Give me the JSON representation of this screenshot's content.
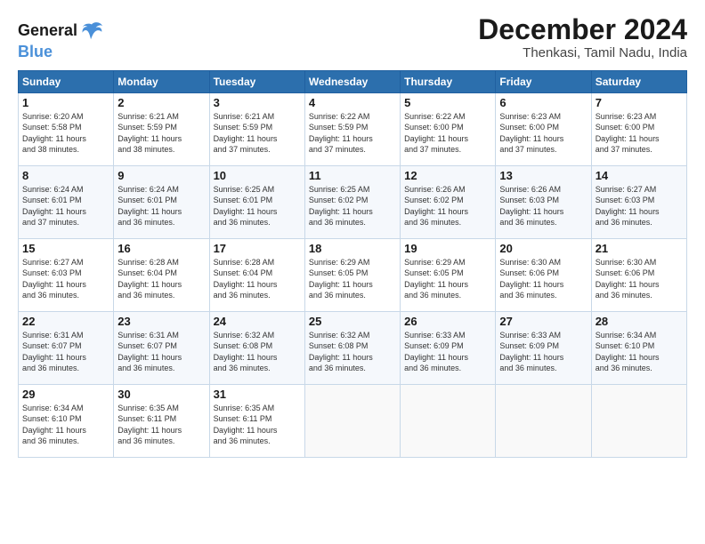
{
  "logo": {
    "line1": "General",
    "line2": "Blue"
  },
  "title": "December 2024",
  "subtitle": "Thenkasi, Tamil Nadu, India",
  "days_of_week": [
    "Sunday",
    "Monday",
    "Tuesday",
    "Wednesday",
    "Thursday",
    "Friday",
    "Saturday"
  ],
  "weeks": [
    [
      {
        "day": "1",
        "info": "Sunrise: 6:20 AM\nSunset: 5:58 PM\nDaylight: 11 hours\nand 38 minutes."
      },
      {
        "day": "2",
        "info": "Sunrise: 6:21 AM\nSunset: 5:59 PM\nDaylight: 11 hours\nand 38 minutes."
      },
      {
        "day": "3",
        "info": "Sunrise: 6:21 AM\nSunset: 5:59 PM\nDaylight: 11 hours\nand 37 minutes."
      },
      {
        "day": "4",
        "info": "Sunrise: 6:22 AM\nSunset: 5:59 PM\nDaylight: 11 hours\nand 37 minutes."
      },
      {
        "day": "5",
        "info": "Sunrise: 6:22 AM\nSunset: 6:00 PM\nDaylight: 11 hours\nand 37 minutes."
      },
      {
        "day": "6",
        "info": "Sunrise: 6:23 AM\nSunset: 6:00 PM\nDaylight: 11 hours\nand 37 minutes."
      },
      {
        "day": "7",
        "info": "Sunrise: 6:23 AM\nSunset: 6:00 PM\nDaylight: 11 hours\nand 37 minutes."
      }
    ],
    [
      {
        "day": "8",
        "info": "Sunrise: 6:24 AM\nSunset: 6:01 PM\nDaylight: 11 hours\nand 37 minutes."
      },
      {
        "day": "9",
        "info": "Sunrise: 6:24 AM\nSunset: 6:01 PM\nDaylight: 11 hours\nand 36 minutes."
      },
      {
        "day": "10",
        "info": "Sunrise: 6:25 AM\nSunset: 6:01 PM\nDaylight: 11 hours\nand 36 minutes."
      },
      {
        "day": "11",
        "info": "Sunrise: 6:25 AM\nSunset: 6:02 PM\nDaylight: 11 hours\nand 36 minutes."
      },
      {
        "day": "12",
        "info": "Sunrise: 6:26 AM\nSunset: 6:02 PM\nDaylight: 11 hours\nand 36 minutes."
      },
      {
        "day": "13",
        "info": "Sunrise: 6:26 AM\nSunset: 6:03 PM\nDaylight: 11 hours\nand 36 minutes."
      },
      {
        "day": "14",
        "info": "Sunrise: 6:27 AM\nSunset: 6:03 PM\nDaylight: 11 hours\nand 36 minutes."
      }
    ],
    [
      {
        "day": "15",
        "info": "Sunrise: 6:27 AM\nSunset: 6:03 PM\nDaylight: 11 hours\nand 36 minutes."
      },
      {
        "day": "16",
        "info": "Sunrise: 6:28 AM\nSunset: 6:04 PM\nDaylight: 11 hours\nand 36 minutes."
      },
      {
        "day": "17",
        "info": "Sunrise: 6:28 AM\nSunset: 6:04 PM\nDaylight: 11 hours\nand 36 minutes."
      },
      {
        "day": "18",
        "info": "Sunrise: 6:29 AM\nSunset: 6:05 PM\nDaylight: 11 hours\nand 36 minutes."
      },
      {
        "day": "19",
        "info": "Sunrise: 6:29 AM\nSunset: 6:05 PM\nDaylight: 11 hours\nand 36 minutes."
      },
      {
        "day": "20",
        "info": "Sunrise: 6:30 AM\nSunset: 6:06 PM\nDaylight: 11 hours\nand 36 minutes."
      },
      {
        "day": "21",
        "info": "Sunrise: 6:30 AM\nSunset: 6:06 PM\nDaylight: 11 hours\nand 36 minutes."
      }
    ],
    [
      {
        "day": "22",
        "info": "Sunrise: 6:31 AM\nSunset: 6:07 PM\nDaylight: 11 hours\nand 36 minutes."
      },
      {
        "day": "23",
        "info": "Sunrise: 6:31 AM\nSunset: 6:07 PM\nDaylight: 11 hours\nand 36 minutes."
      },
      {
        "day": "24",
        "info": "Sunrise: 6:32 AM\nSunset: 6:08 PM\nDaylight: 11 hours\nand 36 minutes."
      },
      {
        "day": "25",
        "info": "Sunrise: 6:32 AM\nSunset: 6:08 PM\nDaylight: 11 hours\nand 36 minutes."
      },
      {
        "day": "26",
        "info": "Sunrise: 6:33 AM\nSunset: 6:09 PM\nDaylight: 11 hours\nand 36 minutes."
      },
      {
        "day": "27",
        "info": "Sunrise: 6:33 AM\nSunset: 6:09 PM\nDaylight: 11 hours\nand 36 minutes."
      },
      {
        "day": "28",
        "info": "Sunrise: 6:34 AM\nSunset: 6:10 PM\nDaylight: 11 hours\nand 36 minutes."
      }
    ],
    [
      {
        "day": "29",
        "info": "Sunrise: 6:34 AM\nSunset: 6:10 PM\nDaylight: 11 hours\nand 36 minutes."
      },
      {
        "day": "30",
        "info": "Sunrise: 6:35 AM\nSunset: 6:11 PM\nDaylight: 11 hours\nand 36 minutes."
      },
      {
        "day": "31",
        "info": "Sunrise: 6:35 AM\nSunset: 6:11 PM\nDaylight: 11 hours\nand 36 minutes."
      },
      {
        "day": "",
        "info": ""
      },
      {
        "day": "",
        "info": ""
      },
      {
        "day": "",
        "info": ""
      },
      {
        "day": "",
        "info": ""
      }
    ]
  ]
}
